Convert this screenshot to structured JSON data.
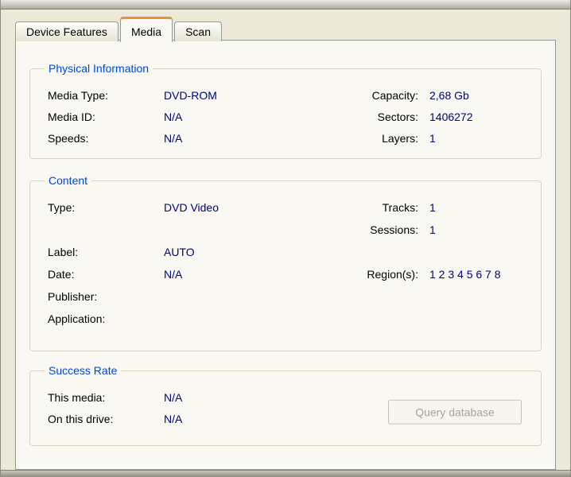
{
  "tabs": [
    {
      "label": "Device Features"
    },
    {
      "label": "Media"
    },
    {
      "label": "Scan"
    }
  ],
  "physical": {
    "title": "Physical Information",
    "left": [
      {
        "label": "Media Type:",
        "value": "DVD-ROM"
      },
      {
        "label": "Media ID:",
        "value": "N/A"
      },
      {
        "label": "Speeds:",
        "value": "N/A"
      }
    ],
    "right": [
      {
        "label": "Capacity:",
        "value": "2,68 Gb"
      },
      {
        "label": "Sectors:",
        "value": "1406272"
      },
      {
        "label": "Layers:",
        "value": "1"
      }
    ]
  },
  "content": {
    "title": "Content",
    "left": [
      {
        "label": "Type:",
        "value": "DVD Video"
      },
      {
        "label": "Label:",
        "value": "AUTO"
      },
      {
        "label": "Date:",
        "value": "N/A"
      },
      {
        "label": "Publisher:",
        "value": ""
      },
      {
        "label": "Application:",
        "value": ""
      }
    ],
    "right": [
      {
        "label": "Tracks:",
        "value": "1"
      },
      {
        "label": "Sessions:",
        "value": "1"
      },
      {
        "label": "Region(s):",
        "value": "1 2 3 4 5 6 7 8"
      }
    ]
  },
  "success": {
    "title": "Success Rate",
    "rows": [
      {
        "label": "This media:",
        "value": "N/A"
      },
      {
        "label": "On this drive:",
        "value": "N/A"
      }
    ],
    "button_label": "Query database"
  },
  "colors": {
    "dialog_background": "#ECE9D8",
    "page_background": "#F9F8F2",
    "group_title": "#0046D5",
    "value_text": "#000080",
    "label_text": "#000000",
    "active_tab_highlight": "#E5932F",
    "disabled_button_text": "#A8A595"
  }
}
